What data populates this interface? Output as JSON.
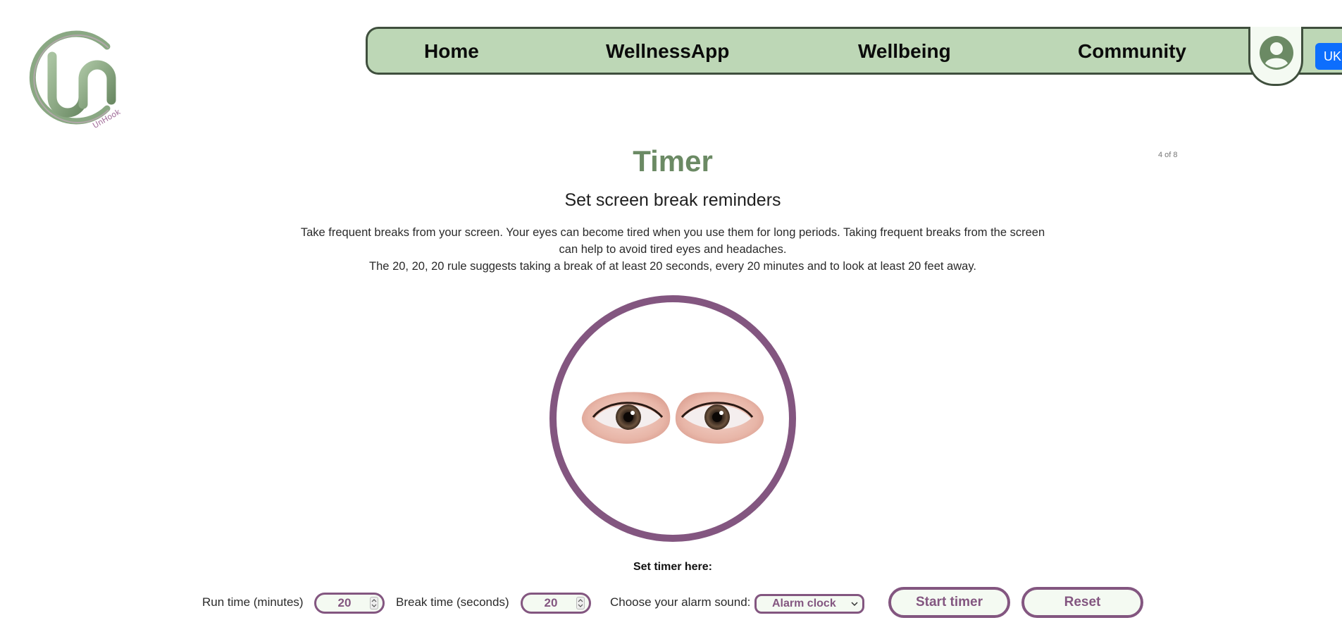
{
  "logo": {
    "text": "UnHook"
  },
  "nav": {
    "items": [
      {
        "label": "Home"
      },
      {
        "label": "WellnessApp"
      },
      {
        "label": "Wellbeing"
      },
      {
        "label": "Community"
      }
    ],
    "profile_icon": "user-circle-icon",
    "language": "UK"
  },
  "page": {
    "counter": "4 of 8",
    "title": "Timer",
    "subtitle": "Set screen break reminders",
    "description_1": "Take frequent breaks from your screen. Your eyes can become tired when you use them for long periods. Taking frequent breaks from the screen can help to avoid tired eyes and headaches.",
    "description_2": "The 20, 20, 20 rule suggests taking a break of at least 20 seconds, every 20 minutes and to look at least 20 feet away."
  },
  "timer": {
    "set_label": "Set timer here:",
    "run_label": "Run time (minutes)",
    "run_value": "20",
    "break_label": "Break time (seconds)",
    "break_value": "20",
    "alarm_label": "Choose your alarm sound:",
    "alarm_selected": "Alarm clock",
    "start_label": "Start timer",
    "reset_label": "Reset"
  },
  "colors": {
    "nav_bg": "#bdd7b6",
    "accent_purple": "#835680",
    "title_green": "#6b8a64",
    "button_bg": "#f4faf2",
    "lang_blue": "#0d6efd"
  }
}
